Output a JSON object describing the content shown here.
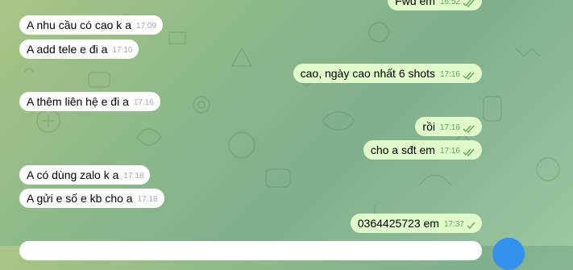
{
  "messages": [
    {
      "side": "out",
      "text": "Fwd em",
      "time": "16:52",
      "status": "read"
    },
    {
      "side": "in",
      "text": "A nhu cầu có cao k a",
      "time": "17:09"
    },
    {
      "side": "in",
      "text": "A add tele e đi a",
      "time": "17:10"
    },
    {
      "side": "out",
      "text": "cao, ngày cao nhất 6 shots",
      "time": "17:16",
      "status": "read"
    },
    {
      "side": "in",
      "text": "A thêm liên hệ e  đi a",
      "time": "17:16"
    },
    {
      "side": "out",
      "text": "rồi",
      "time": "17:16",
      "status": "read"
    },
    {
      "side": "out",
      "text": "cho a sđt em",
      "time": "17:16",
      "status": "read"
    },
    {
      "side": "in",
      "text": "A có dùng zalo k a",
      "time": "17:18"
    },
    {
      "side": "in",
      "text": "A gửi e số e kb cho a",
      "time": "17:18"
    },
    {
      "side": "out",
      "text": "0364425723 em",
      "time": "17:37",
      "status": "sent"
    }
  ],
  "colors": {
    "incoming_bubble": "#ffffff",
    "outgoing_bubble": "#e0fbc9",
    "outgoing_meta": "#5fa85a",
    "incoming_meta": "#a3a8ad",
    "accent": "#3390ec"
  }
}
